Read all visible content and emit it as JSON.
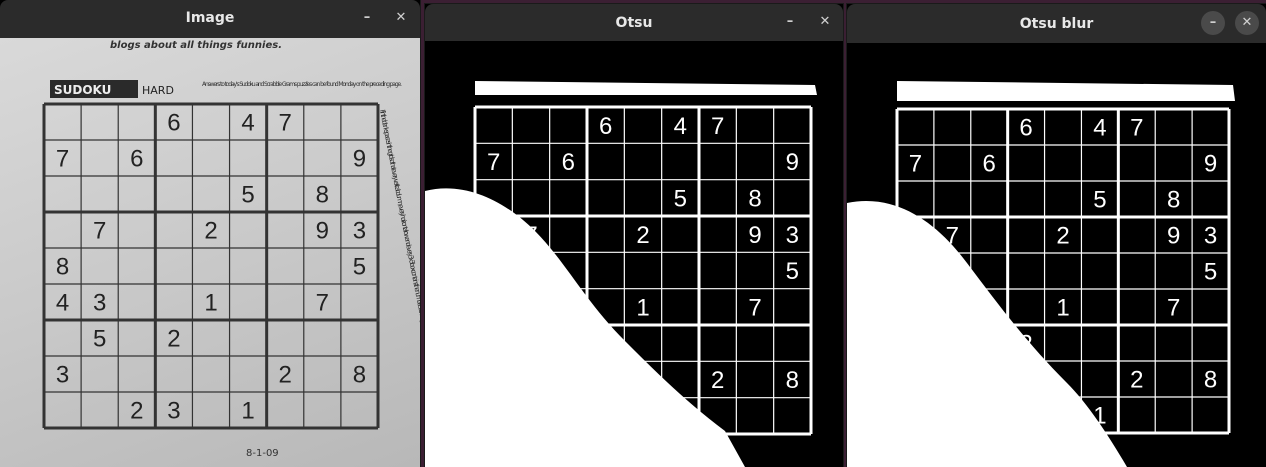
{
  "windows": [
    {
      "title": "Image",
      "min": "–",
      "close": "✕"
    },
    {
      "title": "Otsu",
      "min": "–",
      "close": "✕"
    },
    {
      "title": "Otsu blur",
      "min": "–",
      "close": "✕"
    }
  ],
  "paper": {
    "header_text": "blogs about all things funnies.",
    "sudoku_label": "SUDOKU",
    "difficulty": "HARD",
    "answers_note": "Answers to today's Sudoku and Scrabble Grams puzzles can be found Monday on the preceding page.",
    "side_instructions": "Fill in the blank spaces in the grid so that every vertical column, every horizontal row and every 3x3 box contains the numbers 1 through 9, without repeating any.",
    "date": "8-1-09"
  },
  "sudoku_givens": [
    {
      "r": 0,
      "c": 3,
      "v": "6"
    },
    {
      "r": 0,
      "c": 5,
      "v": "4"
    },
    {
      "r": 0,
      "c": 6,
      "v": "7"
    },
    {
      "r": 1,
      "c": 0,
      "v": "7"
    },
    {
      "r": 1,
      "c": 2,
      "v": "6"
    },
    {
      "r": 1,
      "c": 8,
      "v": "9"
    },
    {
      "r": 2,
      "c": 5,
      "v": "5"
    },
    {
      "r": 2,
      "c": 7,
      "v": "8"
    },
    {
      "r": 3,
      "c": 1,
      "v": "7"
    },
    {
      "r": 3,
      "c": 4,
      "v": "2"
    },
    {
      "r": 3,
      "c": 7,
      "v": "9"
    },
    {
      "r": 3,
      "c": 8,
      "v": "3"
    },
    {
      "r": 4,
      "c": 0,
      "v": "8"
    },
    {
      "r": 4,
      "c": 8,
      "v": "5"
    },
    {
      "r": 5,
      "c": 0,
      "v": "4"
    },
    {
      "r": 5,
      "c": 1,
      "v": "3"
    },
    {
      "r": 5,
      "c": 4,
      "v": "1"
    },
    {
      "r": 5,
      "c": 7,
      "v": "7"
    },
    {
      "r": 6,
      "c": 1,
      "v": "5"
    },
    {
      "r": 6,
      "c": 3,
      "v": "2"
    },
    {
      "r": 7,
      "c": 0,
      "v": "3"
    },
    {
      "r": 7,
      "c": 6,
      "v": "2"
    },
    {
      "r": 7,
      "c": 8,
      "v": "8"
    },
    {
      "r": 8,
      "c": 2,
      "v": "2"
    },
    {
      "r": 8,
      "c": 3,
      "v": "3"
    },
    {
      "r": 8,
      "c": 5,
      "v": "1"
    }
  ],
  "colors": {
    "desktop": "#3b1f33",
    "titlebar": "#2b2b2b",
    "title_text": "#e8e8e8",
    "threshold_fg": "#ffffff",
    "threshold_bg": "#000000"
  }
}
